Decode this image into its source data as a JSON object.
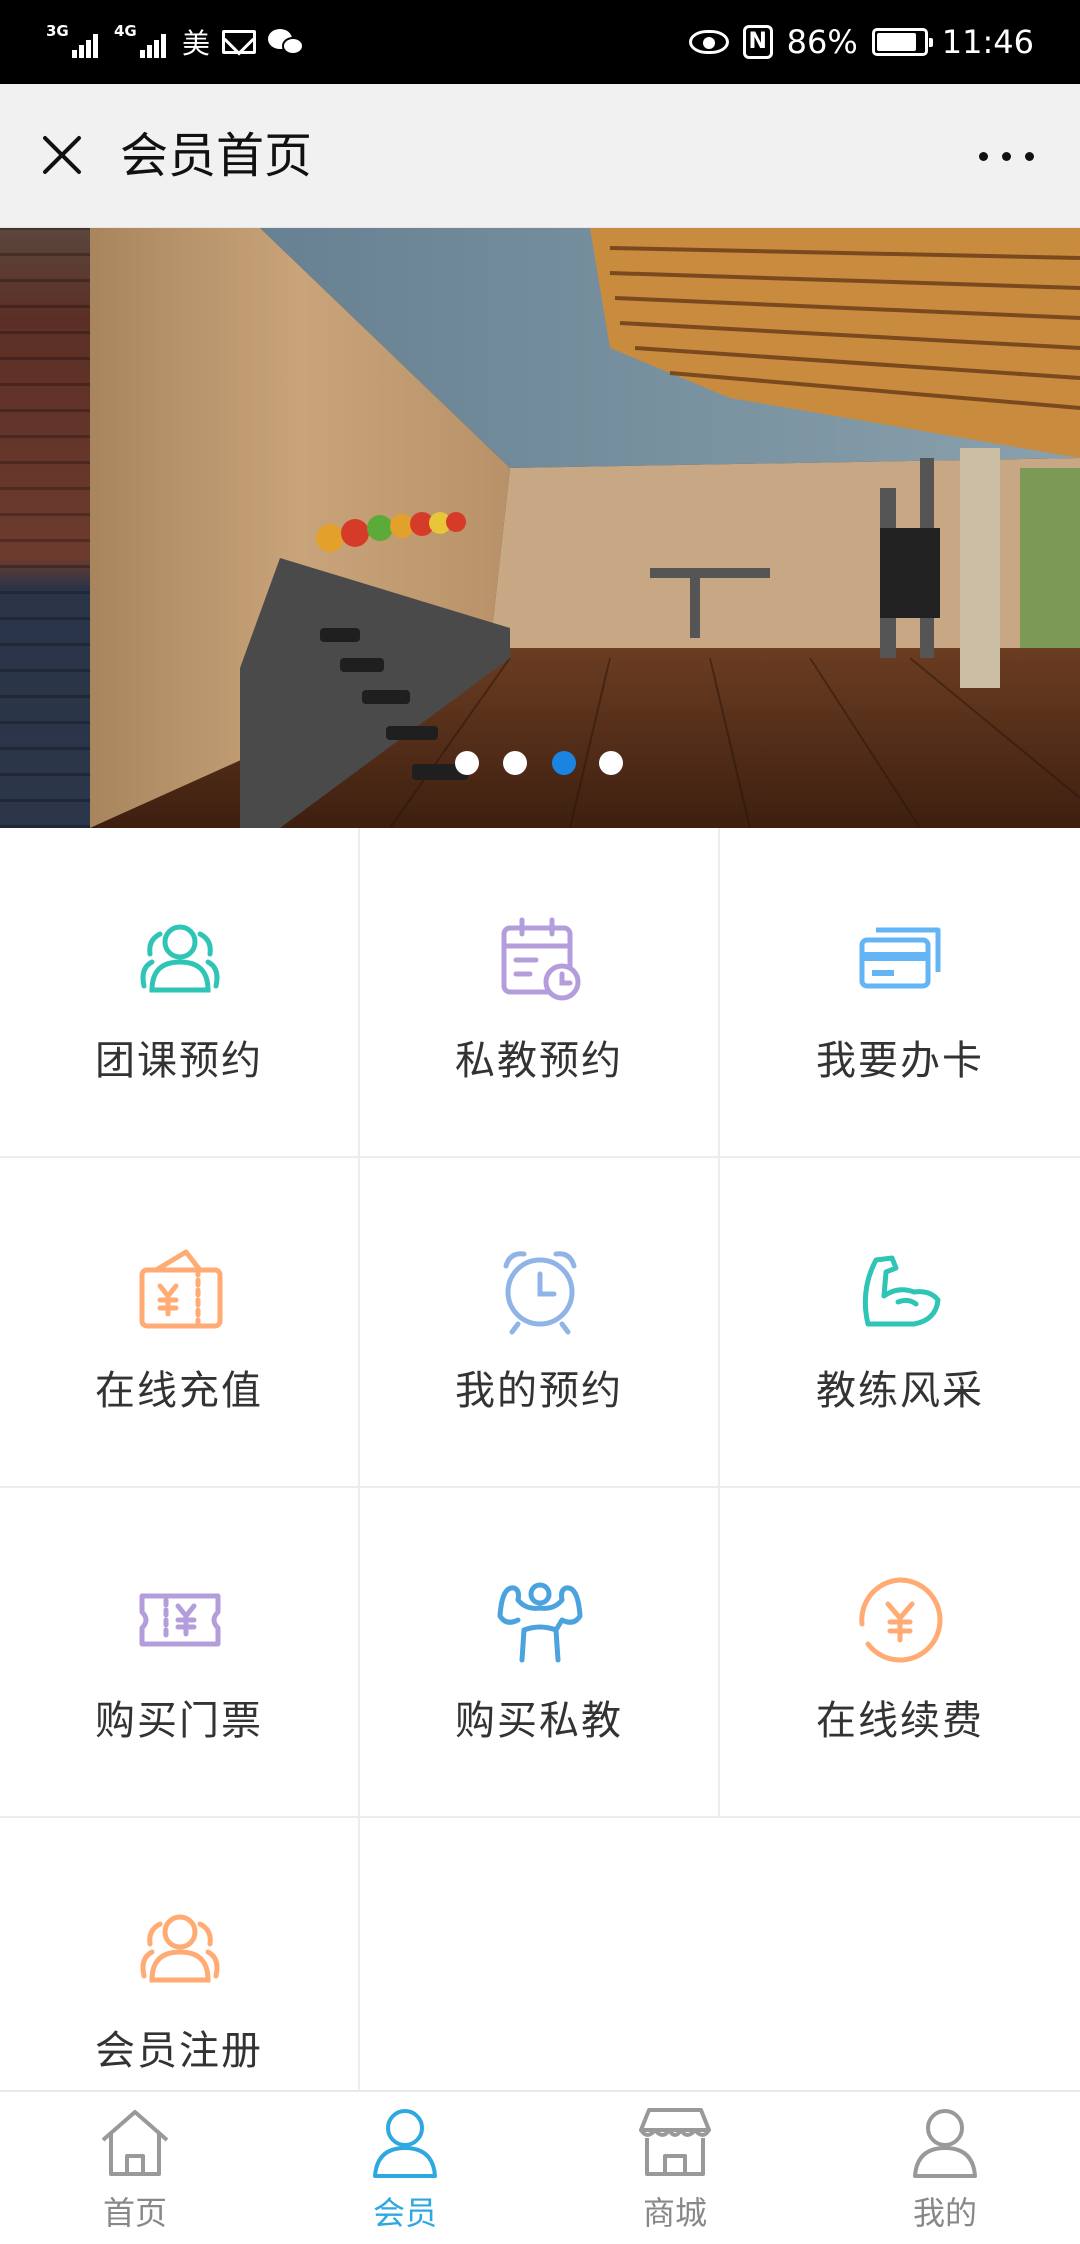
{
  "status_bar": {
    "network_1": "3G",
    "network_2": "4G",
    "carrier": "美",
    "battery": "86%",
    "battery_level": 0.86,
    "time": "11:46",
    "icons": [
      "signal-icon",
      "mail-icon",
      "wechat-icon",
      "eye-icon",
      "nfc-icon",
      "battery-icon"
    ]
  },
  "header": {
    "title": "会员首页",
    "close_icon": "close-icon",
    "more_icon": "more-icon"
  },
  "banner": {
    "slide_count": 4,
    "active_index": 2,
    "active_color": "#1b84e0"
  },
  "grid": {
    "items": [
      {
        "label": "团课预约",
        "icon": "group-icon",
        "color": "#2ec4b6"
      },
      {
        "label": "私教预约",
        "icon": "calendar-icon",
        "color": "#b39ddb"
      },
      {
        "label": "我要办卡",
        "icon": "card-icon",
        "color": "#64b5f6"
      },
      {
        "label": "在线充值",
        "icon": "wallet-icon",
        "color": "#ffab73"
      },
      {
        "label": "我的预约",
        "icon": "alarm-clock-icon",
        "color": "#90b4e8"
      },
      {
        "label": "教练风采",
        "icon": "muscle-arm-icon",
        "color": "#2ec4b6"
      },
      {
        "label": "购买门票",
        "icon": "ticket-icon",
        "color": "#b39ddb"
      },
      {
        "label": "购买私教",
        "icon": "trainer-icon",
        "color": "#4aa3df"
      },
      {
        "label": "在线续费",
        "icon": "yuan-coin-icon",
        "color": "#ffab73"
      },
      {
        "label": "会员注册",
        "icon": "register-group-icon",
        "color": "#ffab73"
      }
    ]
  },
  "tabbar": {
    "active_color": "#2fa7e0",
    "items": [
      {
        "label": "首页",
        "icon": "home-icon",
        "active": false
      },
      {
        "label": "会员",
        "icon": "member-icon",
        "active": true
      },
      {
        "label": "商城",
        "icon": "store-icon",
        "active": false
      },
      {
        "label": "我的",
        "icon": "profile-icon",
        "active": false
      }
    ]
  }
}
